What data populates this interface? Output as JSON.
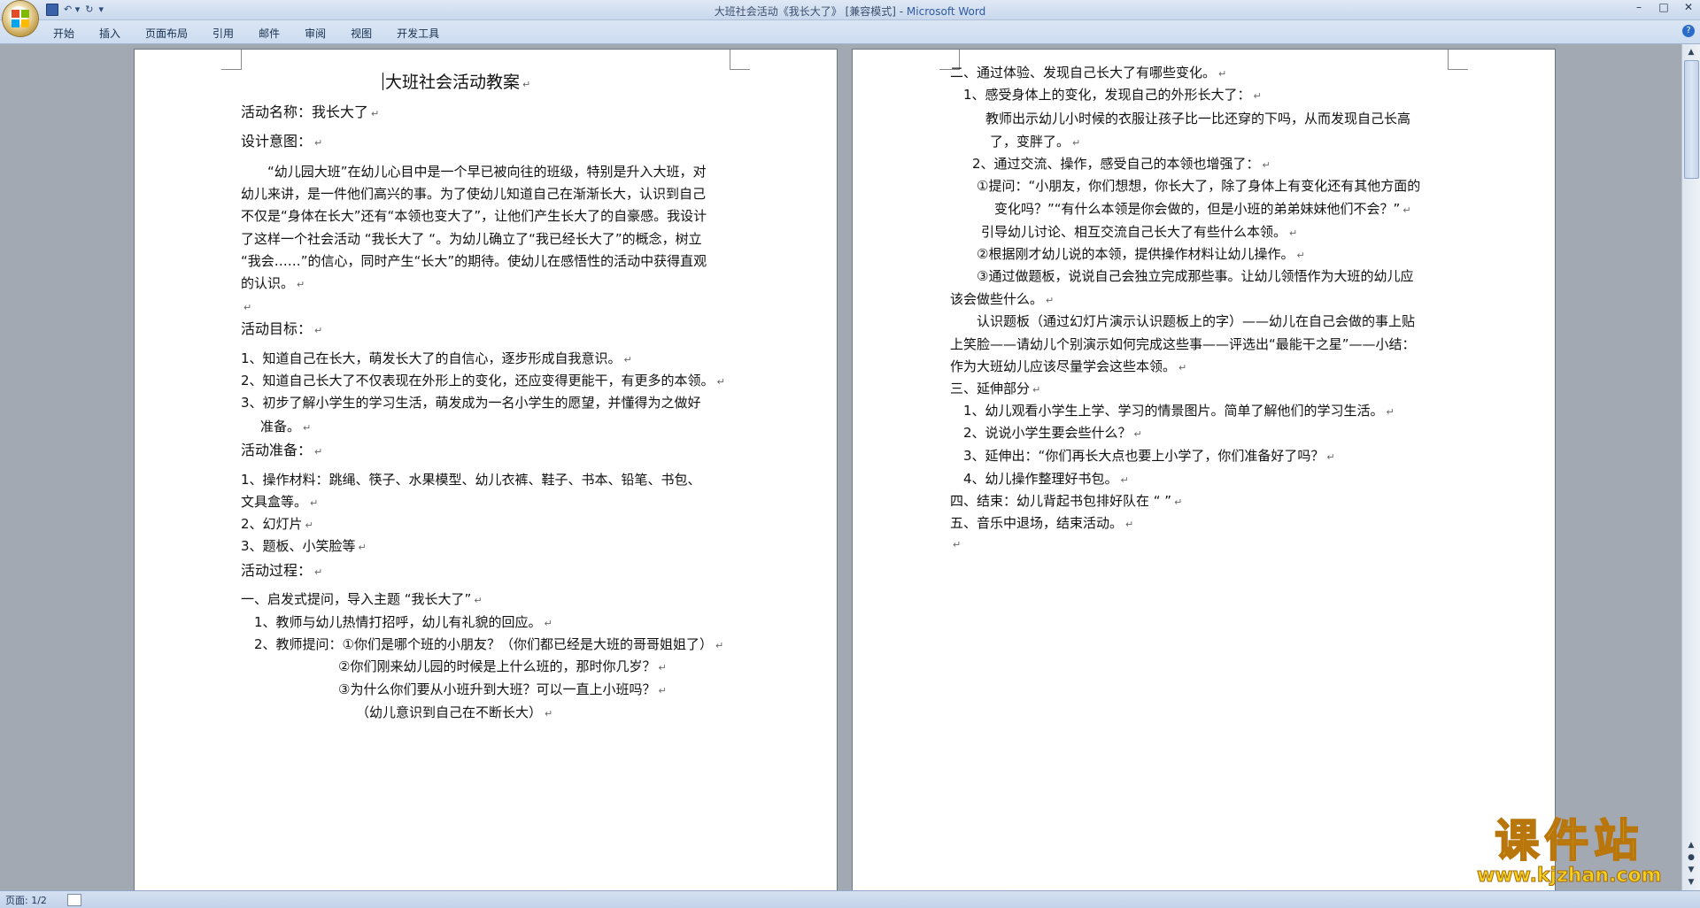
{
  "window": {
    "title": "大班社会活动《我长大了》 [兼容模式] - ",
    "app_name": "Microsoft Word",
    "controls": [
      "–",
      "□",
      "✕"
    ]
  },
  "ribbon": {
    "tabs": [
      "开始",
      "插入",
      "页面布局",
      "引用",
      "邮件",
      "审阅",
      "视图",
      "开发工具"
    ],
    "help": "?"
  },
  "status": {
    "page": "页面: 1/2"
  },
  "paragraph_mark": "↵",
  "page1": [
    "大班社会活动教案",
    "活动名称：我长大了",
    "设计意图：",
    "“幼儿园大班”在幼儿心目中是一个早已被向往的班级，特别是升入大班，对",
    "幼儿来讲，是一件他们高兴的事。为了使幼儿知道自己在渐渐长大，认识到自己",
    "不仅是“身体在长大”还有“本领也变大了”，让他们产生长大了的自豪感。我设计",
    "了这样一个社会活动 “我长大了 “。为幼儿确立了“我已经长大了”的概念，树立",
    "“我会……”的信心，同时产生“长大”的期待。使幼儿在感悟性的活动中获得直观",
    "的认识。",
    "",
    "活动目标：",
    "1、知道自己在长大，萌发长大了的自信心，逐步形成自我意识。",
    "2、知道自己长大了不仅表现在外形上的变化，还应变得更能干，有更多的本领。",
    "3、初步了解小学生的学习生活，萌发成为一名小学生的愿望，并懂得为之做好",
    "准备。",
    "活动准备：",
    "1、操作材料：跳绳、筷子、水果模型、幼儿衣裤、鞋子、书本、铅笔、书包、",
    "文具盒等。",
    "2、幻灯片",
    "3、题板、小笑脸等",
    "活动过程：",
    "一、启发式提问，导入主题 “我长大了”",
    "1、教师与幼儿热情打招呼，幼儿有礼貌的回应。",
    "2、教师提问：①你们是哪个班的小朋友？（你们都已经是大班的哥哥姐姐了）",
    "②你们刚来幼儿园的时候是上什么班的，那时你几岁？",
    "③为什么你们要从小班升到大班？可以一直上小班吗？",
    "（幼儿意识到自己在不断长大）"
  ],
  "page2": [
    "二、通过体验、发现自己长大了有哪些变化。",
    "1、感受身体上的变化，发现自己的外形长大了：",
    "教师出示幼儿小时候的衣服让孩子比一比还穿的下吗，从而发现自己长高",
    "了，变胖了。",
    "2、通过交流、操作，感受自己的本领也增强了：",
    "①提问：“小朋友，你们想想，你长大了，除了身体上有变化还有其他方面的",
    "变化吗？”“有什么本领是你会做的，但是小班的弟弟妹妹他们不会？”",
    "引导幼儿讨论、相互交流自己长大了有些什么本领。",
    "②根据刚才幼儿说的本领，提供操作材料让幼儿操作。",
    "③通过做题板，说说自己会独立完成那些事。让幼儿领悟作为大班的幼儿应",
    "该会做些什么。",
    "认识题板（通过幻灯片演示认识题板上的字）——幼儿在自己会做的事上贴",
    "上笑脸——请幼儿个别演示如何完成这些事——评选出“最能干之星”——小结：",
    "作为大班幼儿应该尽量学会这些本领。",
    "三、延伸部分",
    "1、幼儿观看小学生上学、学习的情景图片。简单了解他们的学习生活。",
    "2、说说小学生要会些什么？",
    "3、延伸出：“你们再长大点也要上小学了，你们准备好了吗？",
    "4、幼儿操作整理好书包。",
    "四、结束：幼儿背起书包排好队在 “ ”",
    "五、音乐中退场，结束活动。",
    ""
  ],
  "watermark": {
    "big": "课件站",
    "small": "www.kjzhan.com"
  }
}
